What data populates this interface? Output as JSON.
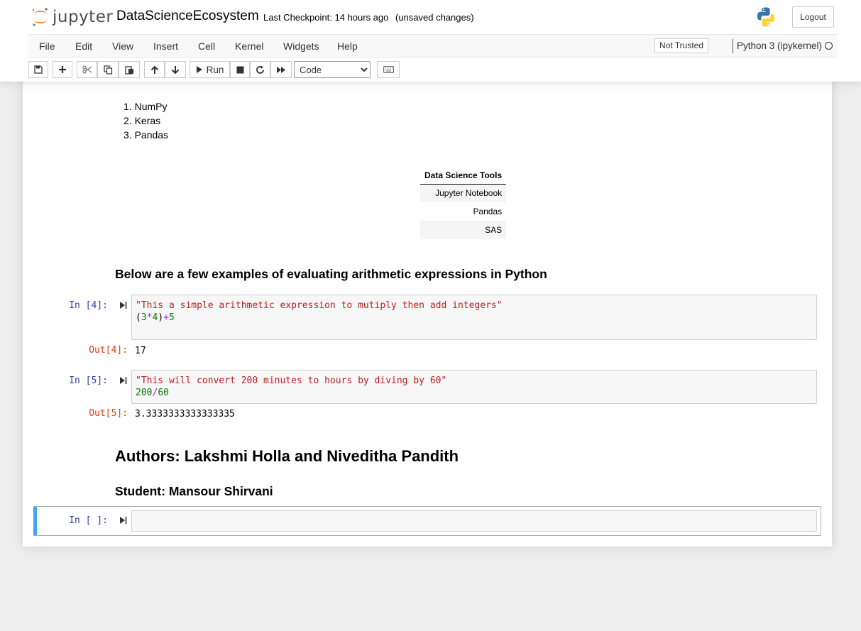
{
  "header": {
    "logo_text": "jupyter",
    "notebook_name": "DataScienceEcosystem",
    "checkpoint": "Last Checkpoint: 14 hours ago",
    "autosave_status": "(unsaved changes)",
    "logout_label": "Logout"
  },
  "menubar": {
    "items": [
      "File",
      "Edit",
      "View",
      "Insert",
      "Cell",
      "Kernel",
      "Widgets",
      "Help"
    ],
    "trusted_label": "Not Trusted",
    "kernel_name": "Python 3 (ipykernel)"
  },
  "toolbar": {
    "run_label": "Run",
    "cell_type_options": [
      "Code"
    ],
    "cell_type_selected": "Code",
    "icons": [
      "save-icon",
      "plus-icon",
      "cut-icon",
      "copy-icon",
      "paste-icon",
      "arrow-up-icon",
      "arrow-down-icon",
      "run-icon",
      "stop-icon",
      "restart-icon",
      "fast-forward-icon",
      "keyboard-icon"
    ]
  },
  "notebook": {
    "library_list": [
      "NumPy",
      "Keras",
      "Pandas"
    ],
    "tools_table": {
      "header": "Data Science Tools",
      "rows": [
        "Jupyter Notebook",
        "Pandas",
        "SAS"
      ]
    },
    "examples_heading": "Below are a few examples of evaluating arithmetic expressions in Python",
    "cells": [
      {
        "in_prompt": "In [4]:",
        "code_line1": "\"This a simple arithmetic expression to mutiply then add integers\"",
        "code_line2": [
          "(",
          "3",
          "*",
          "4",
          ")",
          "+",
          "5"
        ],
        "out_prompt": "Out[4]:",
        "output": "17"
      },
      {
        "in_prompt": "In [5]:",
        "code_line1": "\"This will convert 200 minutes to hours by diving by 60\"",
        "code_line2": [
          "200",
          "/",
          "60"
        ],
        "out_prompt": "Out[5]:",
        "output": "3.3333333333333335"
      }
    ],
    "authors_heading": "Authors: Lakshmi Holla and Niveditha Pandith",
    "student_heading": "Student: Mansour Shirvani",
    "empty_cell_prompt": "In [ ]:"
  },
  "colors": {
    "accent_selected_cell": "#42a5f5",
    "in_prompt": "#303f9f",
    "out_prompt": "#d84315",
    "string": "#ba2121",
    "number": "#008000",
    "operator": "#aa22ff"
  }
}
